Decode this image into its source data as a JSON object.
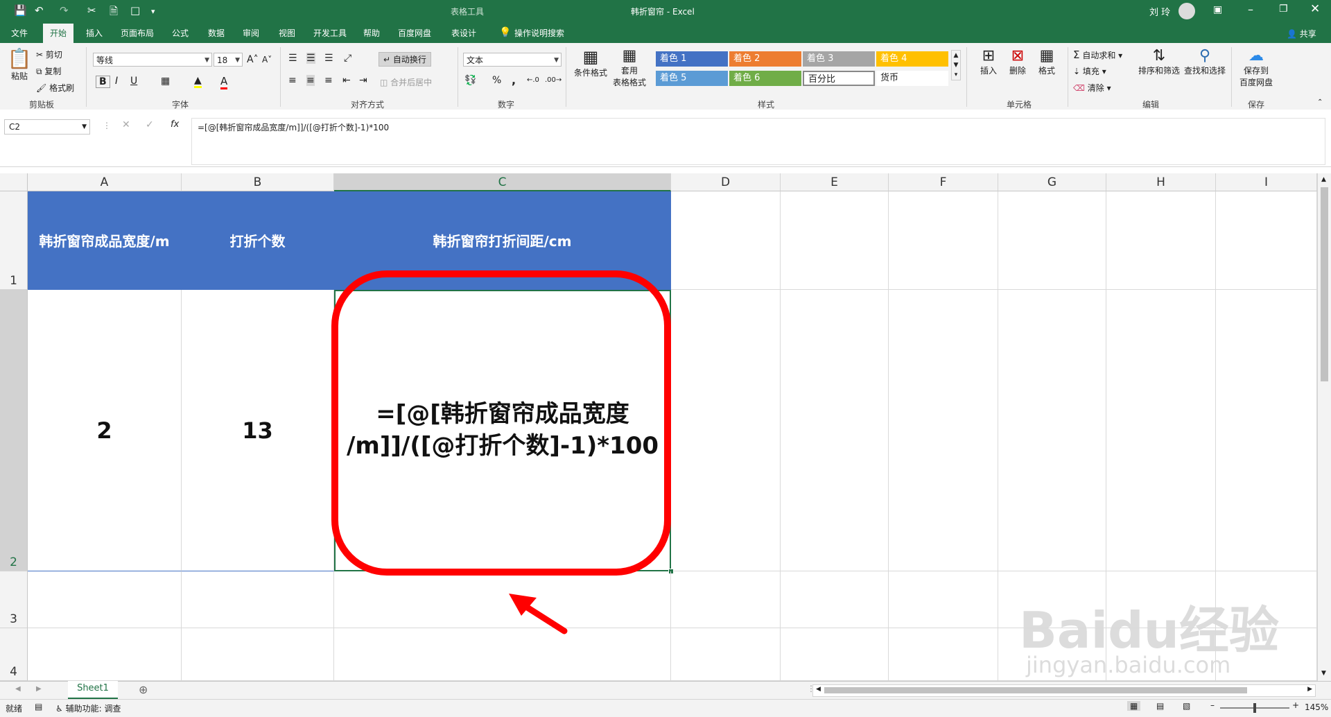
{
  "title_bar": {
    "doc_title": "韩折窗帘",
    "app_name": "Excel",
    "separator": " - ",
    "context_tool": "表格工具",
    "user": "刘 玲"
  },
  "tabs": [
    {
      "label": "文件"
    },
    {
      "label": "开始"
    },
    {
      "label": "插入"
    },
    {
      "label": "页面布局"
    },
    {
      "label": "公式"
    },
    {
      "label": "数据"
    },
    {
      "label": "审阅"
    },
    {
      "label": "视图"
    },
    {
      "label": "开发工具"
    },
    {
      "label": "帮助"
    },
    {
      "label": "百度网盘"
    },
    {
      "label": "表设计"
    },
    {
      "label": "操作说明搜索"
    }
  ],
  "share_label": "共享",
  "ribbon": {
    "clipboard": {
      "paste": "粘贴",
      "cut": "剪切",
      "copy": "复制",
      "format_painter": "格式刷",
      "group": "剪贴板"
    },
    "font": {
      "name": "等线",
      "size": "18",
      "bold": "B",
      "italic": "I",
      "underline": "U",
      "group": "字体"
    },
    "alignment": {
      "wrap": "自动换行",
      "merge": "合并后居中",
      "group": "对齐方式"
    },
    "number": {
      "format": "文本",
      "percent": "%",
      "comma": ",",
      "group": "数字"
    },
    "styles": {
      "conditional": "条件格式",
      "table_format_1": "套用",
      "table_format_2": "表格格式",
      "cells": [
        {
          "label": "着色 1",
          "bg": "#4472c4",
          "fg": "#ffffff"
        },
        {
          "label": "着色 2",
          "bg": "#ed7d31",
          "fg": "#ffffff"
        },
        {
          "label": "着色 3",
          "bg": "#a5a5a5",
          "fg": "#ffffff"
        },
        {
          "label": "着色 4",
          "bg": "#ffc000",
          "fg": "#ffffff"
        },
        {
          "label": "着色 5",
          "bg": "#5b9bd5",
          "fg": "#ffffff"
        },
        {
          "label": "着色 6",
          "bg": "#70ad47",
          "fg": "#ffffff"
        },
        {
          "label": "百分比",
          "bg": "#ffffff",
          "fg": "#222222"
        },
        {
          "label": "货币",
          "bg": "#ffffff",
          "fg": "#222222"
        }
      ],
      "group": "样式"
    },
    "cells_group": {
      "insert": "插入",
      "delete": "删除",
      "format": "格式",
      "group": "单元格"
    },
    "editing": {
      "autosum": "自动求和",
      "fill": "填充",
      "clear": "清除",
      "sort": "排序和筛选",
      "find": "查找和选择",
      "group": "编辑"
    },
    "save": {
      "line1": "保存到",
      "line2": "百度网盘",
      "group": "保存"
    }
  },
  "formula_bar": {
    "name_box": "C2",
    "fx": "fx",
    "formula": "=[@[韩折窗帘成品宽度/m]]/([@打折个数]-1)*100"
  },
  "columns": [
    "A",
    "B",
    "C",
    "D",
    "E",
    "F",
    "G",
    "H",
    "I"
  ],
  "rows": [
    "1",
    "2",
    "3",
    "4"
  ],
  "table": {
    "headers": [
      "韩折窗帘成品宽度/m",
      "打折个数",
      "韩折窗帘打折间距/cm"
    ],
    "row2": {
      "a": "2",
      "b": "13",
      "c_line1": "=[@[韩折窗帘成品宽度",
      "c_line2": "/m]]/([@打折个数]-1)*100"
    }
  },
  "sheet_tab": "Sheet1",
  "status": {
    "ready": "就绪",
    "accessibility": "辅助功能: 调查",
    "zoom": "145%"
  },
  "watermark": {
    "text": "Baidu经验",
    "url": "jingyan.baidu.com"
  }
}
